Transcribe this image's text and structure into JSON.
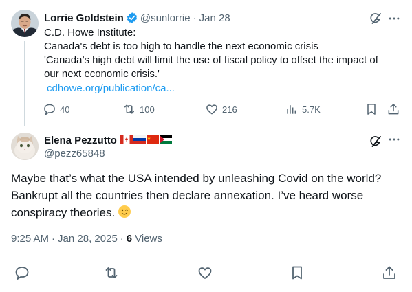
{
  "parent_tweet": {
    "author_name": "Lorrie Goldstein",
    "handle": "@sunlorrie",
    "separator": "·",
    "date": "Jan 28",
    "text_lines": [
      "C.D. Howe Institute:",
      "Canada's debt is too high to handle the next economic crisis",
      "'Canada’s high debt will limit the use of fiscal policy to offset the impact of",
      "our next economic crisis.'"
    ],
    "link": "cdhowe.org/publication/ca...",
    "counts": {
      "replies": "40",
      "reposts": "100",
      "likes": "216",
      "views": "5.7K"
    },
    "icons": [
      "grok-icon",
      "more-icon",
      "reply-icon",
      "repost-icon",
      "like-icon",
      "views-icon",
      "bookmark-icon",
      "share-icon"
    ]
  },
  "main_tweet": {
    "author_name": "Elena Pezzutto",
    "flags": [
      "canada-flag",
      "russia-flag",
      "china-flag",
      "palestine-flag"
    ],
    "handle": "@pezz65848",
    "text_lines": [
      "Maybe that’s what the USA intended by unleashing Covid on the world?",
      "Bankrupt all the countries then declare annexation. I’ve heard worse",
      "conspiracy theories."
    ],
    "emoji": "winking-face",
    "time": "9:25 AM",
    "date": "Jan 28, 2025",
    "separator": "·",
    "views_count": "6",
    "views_label": "Views",
    "icons": [
      "reply-icon",
      "repost-icon",
      "like-icon",
      "bookmark-icon",
      "share-icon"
    ]
  },
  "colors": {
    "text": "#0f1419",
    "secondary": "#536471",
    "link": "#1d9bf0",
    "verified": "#1d9bf0",
    "divider": "#eff3f4"
  }
}
